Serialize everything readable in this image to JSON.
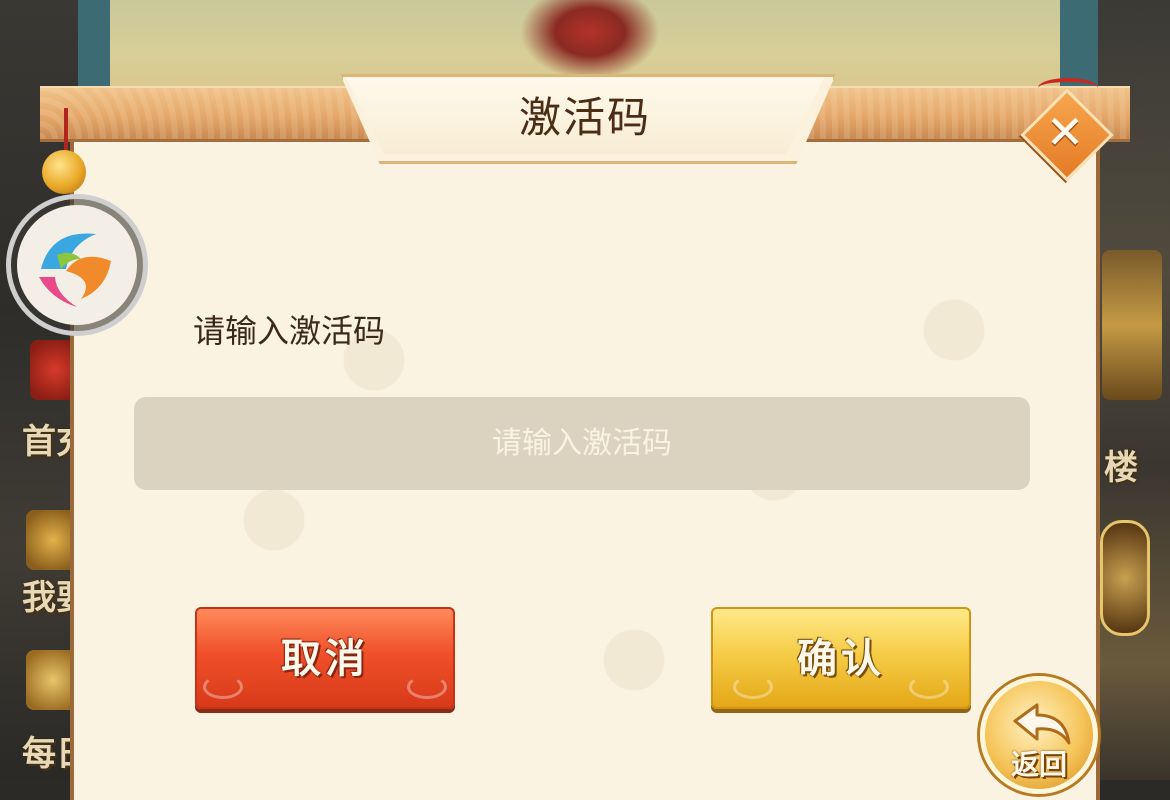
{
  "dialog": {
    "title": "激活码",
    "prompt_label": "请输入激活码",
    "input": {
      "value": "",
      "placeholder": "请输入激活码"
    },
    "cancel_label": "取消",
    "confirm_label": "确认",
    "close_glyph": "✕"
  },
  "background": {
    "left_labels": [
      "首充",
      "我要",
      "每日"
    ],
    "right_labels": [
      "楼"
    ]
  },
  "back_button": {
    "label": "返回"
  },
  "colors": {
    "panel": "#fbf3e2",
    "header": "#e5a86a",
    "cancel": "#f0502a",
    "confirm": "#f6cd47",
    "input_bg": "#dcd2c0",
    "title_text": "#4a2d14"
  },
  "icons": [
    "close-icon",
    "charm-bell-icon",
    "game-logo-icon",
    "back-arrow-icon"
  ]
}
